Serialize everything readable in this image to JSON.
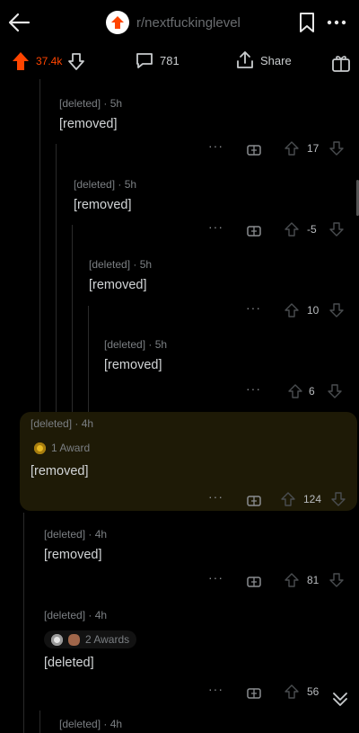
{
  "header": {
    "subreddit": "r/nextfuckinglevel",
    "icons": [
      "back-arrow-icon",
      "subreddit-logo-icon",
      "bookmark-icon",
      "more-dots-icon"
    ]
  },
  "post_actions": {
    "vote_count": "37.4k",
    "comment_count": "781",
    "share_label": "Share"
  },
  "comments": [
    {
      "author": "[deleted]",
      "age": "5h",
      "text": "[removed]",
      "score": "17"
    },
    {
      "author": "[deleted]",
      "age": "5h",
      "text": "[removed]",
      "score": "-5"
    },
    {
      "author": "[deleted]",
      "age": "5h",
      "text": "[removed]",
      "score": "10"
    },
    {
      "author": "[deleted]",
      "age": "5h",
      "text": "[removed]",
      "score": "6"
    },
    {
      "author": "[deleted]",
      "age": "4h",
      "text": "[removed]",
      "score": "124",
      "awards": "1 Award",
      "highlighted": true
    },
    {
      "author": "[deleted]",
      "age": "4h",
      "text": "[removed]",
      "score": "81"
    },
    {
      "author": "[deleted]",
      "age": "4h",
      "text": "[deleted]",
      "score": "56",
      "awards": "2 Awards"
    },
    {
      "author": "[deleted]",
      "age": "4h"
    }
  ],
  "labels": {
    "more": "···",
    "separator": "·"
  },
  "colors": {
    "upvote": "#ff4500",
    "background": "#000000",
    "highlight": "#1e1a06"
  }
}
